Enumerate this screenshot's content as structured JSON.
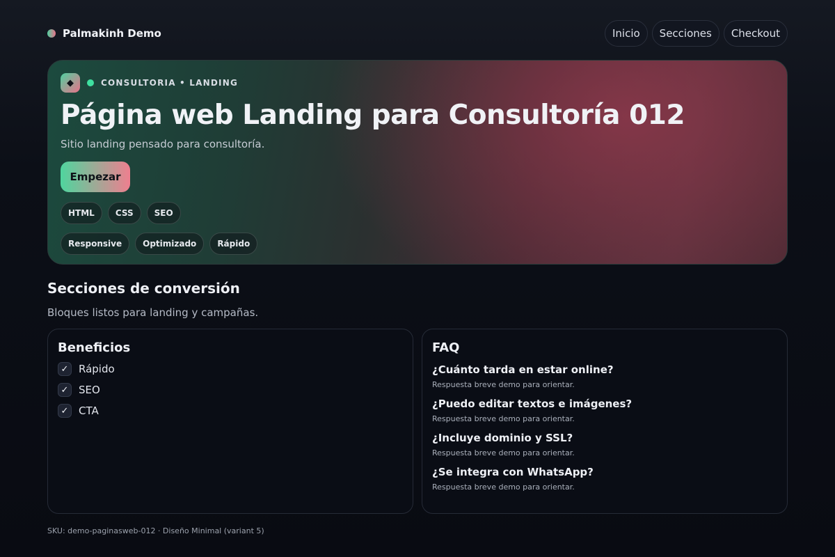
{
  "header": {
    "brand": "Palmakinh Demo",
    "nav": [
      "Inicio",
      "Secciones",
      "Checkout"
    ]
  },
  "hero": {
    "logo_glyph": "◆",
    "kicker": "CONSULTORIA • LANDING",
    "title": "Página web Landing para Consultoría 012",
    "subtitle": "Sitio landing pensado para consultoría.",
    "cta": "Empezar",
    "tags_row1": [
      "HTML",
      "CSS",
      "SEO"
    ],
    "tags_row2": [
      "Responsive",
      "Optimizado",
      "Rápido"
    ]
  },
  "sections": {
    "title": "Secciones de conversión",
    "subtitle": "Bloques listos para landing y campañas."
  },
  "benefits": {
    "title": "Beneficios",
    "check_glyph": "✓",
    "items": [
      "Rápido",
      "SEO",
      "CTA"
    ]
  },
  "faq": {
    "title": "FAQ",
    "items": [
      {
        "q": "¿Cuánto tarda en estar online?",
        "a": "Respuesta breve demo para orientar."
      },
      {
        "q": "¿Puedo editar textos e imágenes?",
        "a": "Respuesta breve demo para orientar."
      },
      {
        "q": "¿Incluye dominio y SSL?",
        "a": "Respuesta breve demo para orientar."
      },
      {
        "q": "¿Se integra con WhatsApp?",
        "a": "Respuesta breve demo para orientar."
      }
    ]
  },
  "footer": {
    "text": "SKU: demo-paginasweb-012 · Diseño Minimal (variant 5)"
  },
  "colors": {
    "accent_green": "#4fd59e",
    "accent_pink": "#ee7f8f",
    "background": "#0b0e16"
  }
}
